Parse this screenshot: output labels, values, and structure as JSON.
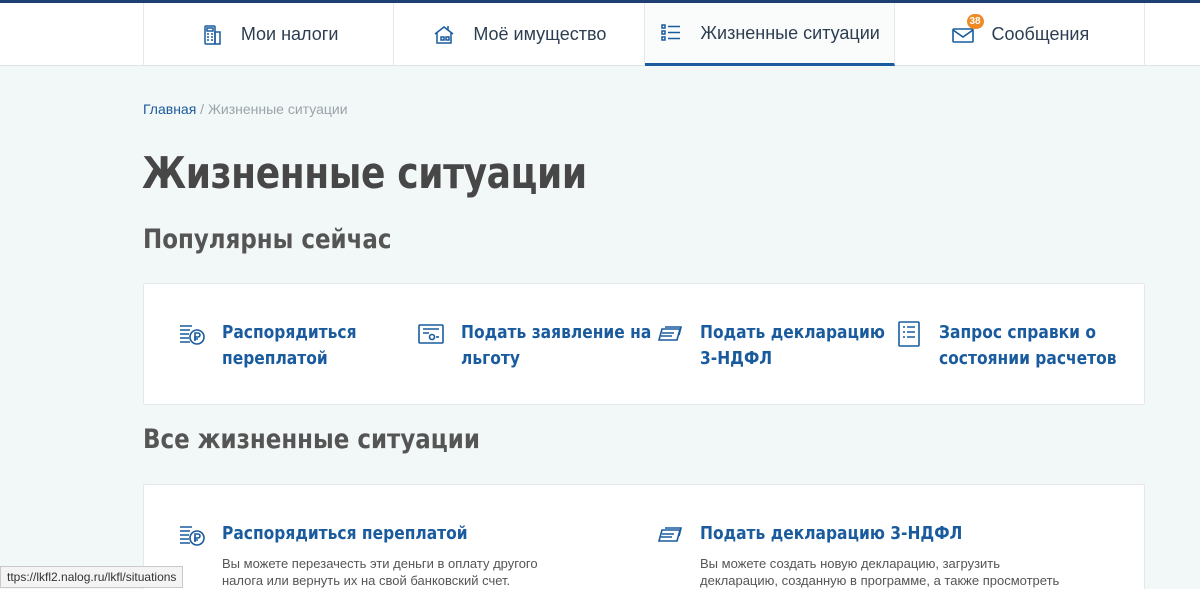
{
  "nav": {
    "items": [
      {
        "label": "Мои налоги",
        "icon": "calculator-icon"
      },
      {
        "label": "Моё имущество",
        "icon": "house-icon"
      },
      {
        "label": "Жизненные ситуации",
        "icon": "list-icon"
      },
      {
        "label": "Сообщения",
        "icon": "envelope-icon",
        "badge": "38"
      }
    ],
    "active_index": 2
  },
  "breadcrumb": {
    "home": "Главная",
    "separator": " / ",
    "current": "Жизненные ситуации"
  },
  "page_title": "Жизненные ситуации",
  "popular": {
    "title": "Популярны сейчас",
    "items": [
      {
        "label": "Распорядиться переплатой",
        "icon": "ruble-coins-icon"
      },
      {
        "label": "Подать заявление на льготу",
        "icon": "certificate-icon"
      },
      {
        "label": "Подать декларацию 3-НДФЛ",
        "icon": "documents-stack-icon"
      },
      {
        "label": "Запрос справки о состоянии расчетов",
        "icon": "document-list-icon"
      }
    ]
  },
  "all": {
    "title": "Все жизненные ситуации",
    "items": [
      {
        "title": "Распорядиться переплатой",
        "desc": "Вы можете перезачесть эти деньги в оплату другого налога или вернуть их на свой банковский счет.",
        "icon": "ruble-coins-icon"
      },
      {
        "title": "Подать декларацию 3-НДФЛ",
        "desc": "Вы можете создать новую декларацию, загрузить декларацию, созданную в программе, а также просмотреть",
        "icon": "documents-stack-icon"
      }
    ]
  },
  "status_url": "ttps://lkfl2.nalog.ru/lkfl/situations",
  "colors": {
    "accent": "#1a5b9e",
    "badge": "#f08a24",
    "background": "#f2f7f7"
  }
}
